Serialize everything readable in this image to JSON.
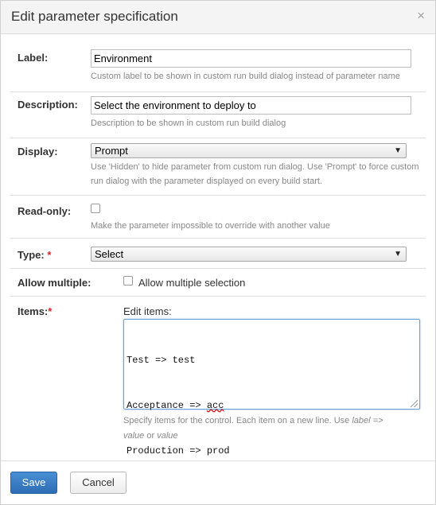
{
  "dialog": {
    "title": "Edit parameter specification",
    "close_glyph": "×"
  },
  "label_field": {
    "label": "Label:",
    "value": "Environment",
    "note": "Custom label to be shown in custom run build dialog instead of parameter name"
  },
  "description_field": {
    "label": "Description:",
    "value": "Select the environment to deploy to",
    "note": "Description to be shown in custom run build dialog"
  },
  "display_field": {
    "label": "Display:",
    "selected": "Prompt",
    "note_line1": "Use 'Hidden' to hide parameter from custom run dialog. Use 'Prompt' to force custom",
    "note_line2": "run dialog with the parameter displayed on every build start."
  },
  "readonly_field": {
    "label": "Read-only:",
    "checked": false,
    "note": "Make the parameter impossible to override with another value"
  },
  "type_field": {
    "label": "Type:",
    "required_mark": "*",
    "selected": "Select"
  },
  "allow_multiple_field": {
    "label": "Allow multiple:",
    "checked": false,
    "checkbox_label": "Allow multiple selection"
  },
  "items_field": {
    "label": "Items:",
    "required_mark": "*",
    "editor_caption": "Edit items:",
    "lines": [
      {
        "pre": "Test => test",
        "squiggle": "",
        "post": ""
      },
      {
        "pre": "Acceptance => ",
        "squiggle": "acc",
        "post": ""
      },
      {
        "pre": "Production => prod",
        "squiggle": "",
        "post": ""
      }
    ],
    "note_line1_pre": "Specify items for the control. Each item on a new line. Use ",
    "note_line1_italic": "label =>",
    "note_line2_italic1": "value",
    "note_line2_mid": " or ",
    "note_line2_italic2": "value"
  },
  "footer": {
    "save_label": "Save",
    "cancel_label": "Cancel"
  },
  "icons": {
    "close": "close-icon",
    "dropdown": "chevron-down-icon",
    "resize": "resize-grip-icon"
  }
}
